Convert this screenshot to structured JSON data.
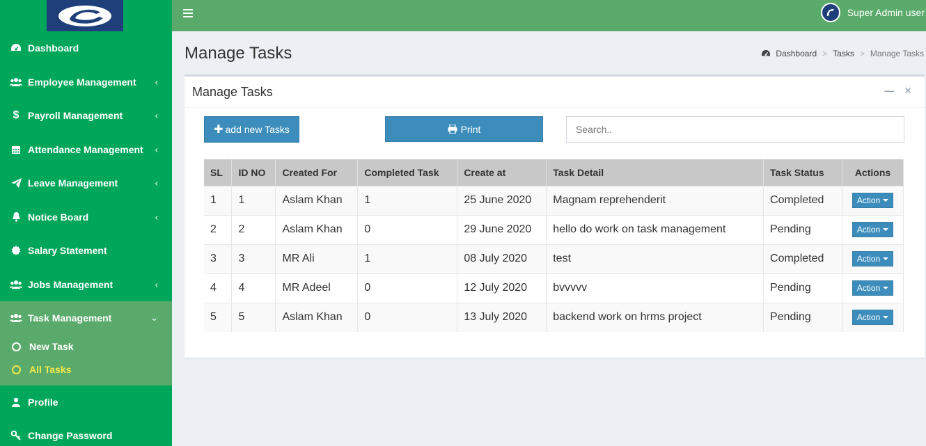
{
  "header": {
    "user_name": "Super Admin user"
  },
  "sidebar": {
    "items": [
      {
        "label": "Dashboard",
        "icon": "dashboard-icon",
        "chevron": false
      },
      {
        "label": "Employee Management",
        "icon": "users-icon",
        "chevron": true
      },
      {
        "label": "Payroll Management",
        "icon": "dollar-icon",
        "chevron": true
      },
      {
        "label": "Attendance Management",
        "icon": "calendar-icon",
        "chevron": true
      },
      {
        "label": "Leave Management",
        "icon": "paper-plane-icon",
        "chevron": true
      },
      {
        "label": "Notice Board",
        "icon": "bell-icon",
        "chevron": true
      },
      {
        "label": "Salary Statement",
        "icon": "certificate-icon",
        "chevron": false
      },
      {
        "label": "Jobs Management",
        "icon": "users-icon",
        "chevron": true
      },
      {
        "label": "Task Management",
        "icon": "users-icon",
        "chevron": true,
        "expanded": true
      },
      {
        "label": "Profile",
        "icon": "user-icon",
        "chevron": false
      },
      {
        "label": "Change Password",
        "icon": "key-icon",
        "chevron": false
      }
    ],
    "task_submenu": [
      {
        "label": "New Task",
        "current": false
      },
      {
        "label": "All Tasks",
        "current": true
      }
    ]
  },
  "page": {
    "title": "Manage Tasks",
    "breadcrumb": [
      "Dashboard",
      "Tasks",
      "Manage Tasks"
    ]
  },
  "box": {
    "title": "Manage Tasks",
    "add_button": "add new Tasks",
    "print_button": "Print",
    "search_placeholder": "Search.."
  },
  "table": {
    "columns": [
      "SL",
      "ID NO",
      "Created For",
      "Completed Task",
      "Create at",
      "Task Detail",
      "Task Status",
      "Actions"
    ],
    "rows": [
      {
        "sl": "1",
        "id": "1",
        "created_for": "Aslam Khan",
        "completed": "1",
        "create_at": "25 June 2020",
        "detail": "Magnam reprehenderit",
        "status": "Completed"
      },
      {
        "sl": "2",
        "id": "2",
        "created_for": "Aslam Khan",
        "completed": "0",
        "create_at": "29 June 2020",
        "detail": "hello do work on task management",
        "status": "Pending"
      },
      {
        "sl": "3",
        "id": "3",
        "created_for": "MR Ali",
        "completed": "1",
        "create_at": "08 July 2020",
        "detail": "test",
        "status": "Completed"
      },
      {
        "sl": "4",
        "id": "4",
        "created_for": "MR Adeel",
        "completed": "0",
        "create_at": "12 July 2020",
        "detail": "bvvvvv",
        "status": "Pending"
      },
      {
        "sl": "5",
        "id": "5",
        "created_for": "Aslam Khan",
        "completed": "0",
        "create_at": "13 July 2020",
        "detail": "backend work on hrms project",
        "status": "Pending"
      }
    ],
    "action_label": "Action"
  },
  "colors": {
    "sidebar_bg": "#00a65a",
    "header_bg": "#5aaa6b",
    "primary_button": "#3c8dbc",
    "active_submenu_text": "#f2e84a"
  }
}
